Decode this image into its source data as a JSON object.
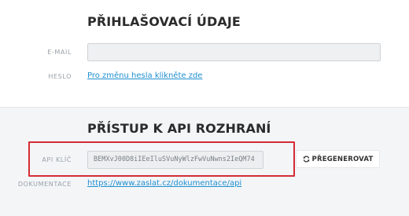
{
  "login_section": {
    "title": "PŘIHLAŠOVACÍ ÚDAJE",
    "email_label": "E-MAIL",
    "email_value": "",
    "password_label": "HESLO",
    "password_link": "Pro změnu hesla klikněte zde"
  },
  "api_section": {
    "title": "PŘÍSTUP K API ROZHRANÍ",
    "key_label": "API KLÍČ",
    "key_value": "BEMXvJ00D8iIEeIluSVuNyWlzFwVuNwns2IeQM74",
    "regenerate_label": "PŘEGENEROVAT",
    "regenerate_icon": "refresh-icon",
    "docs_label": "DOKUMENTACE",
    "docs_link": "https://www.zaslat.cz/dokumentace/api"
  },
  "colors": {
    "accent_link": "#1f8fd1",
    "highlight": "#d42d35",
    "api_background": "#f3f5f7"
  }
}
